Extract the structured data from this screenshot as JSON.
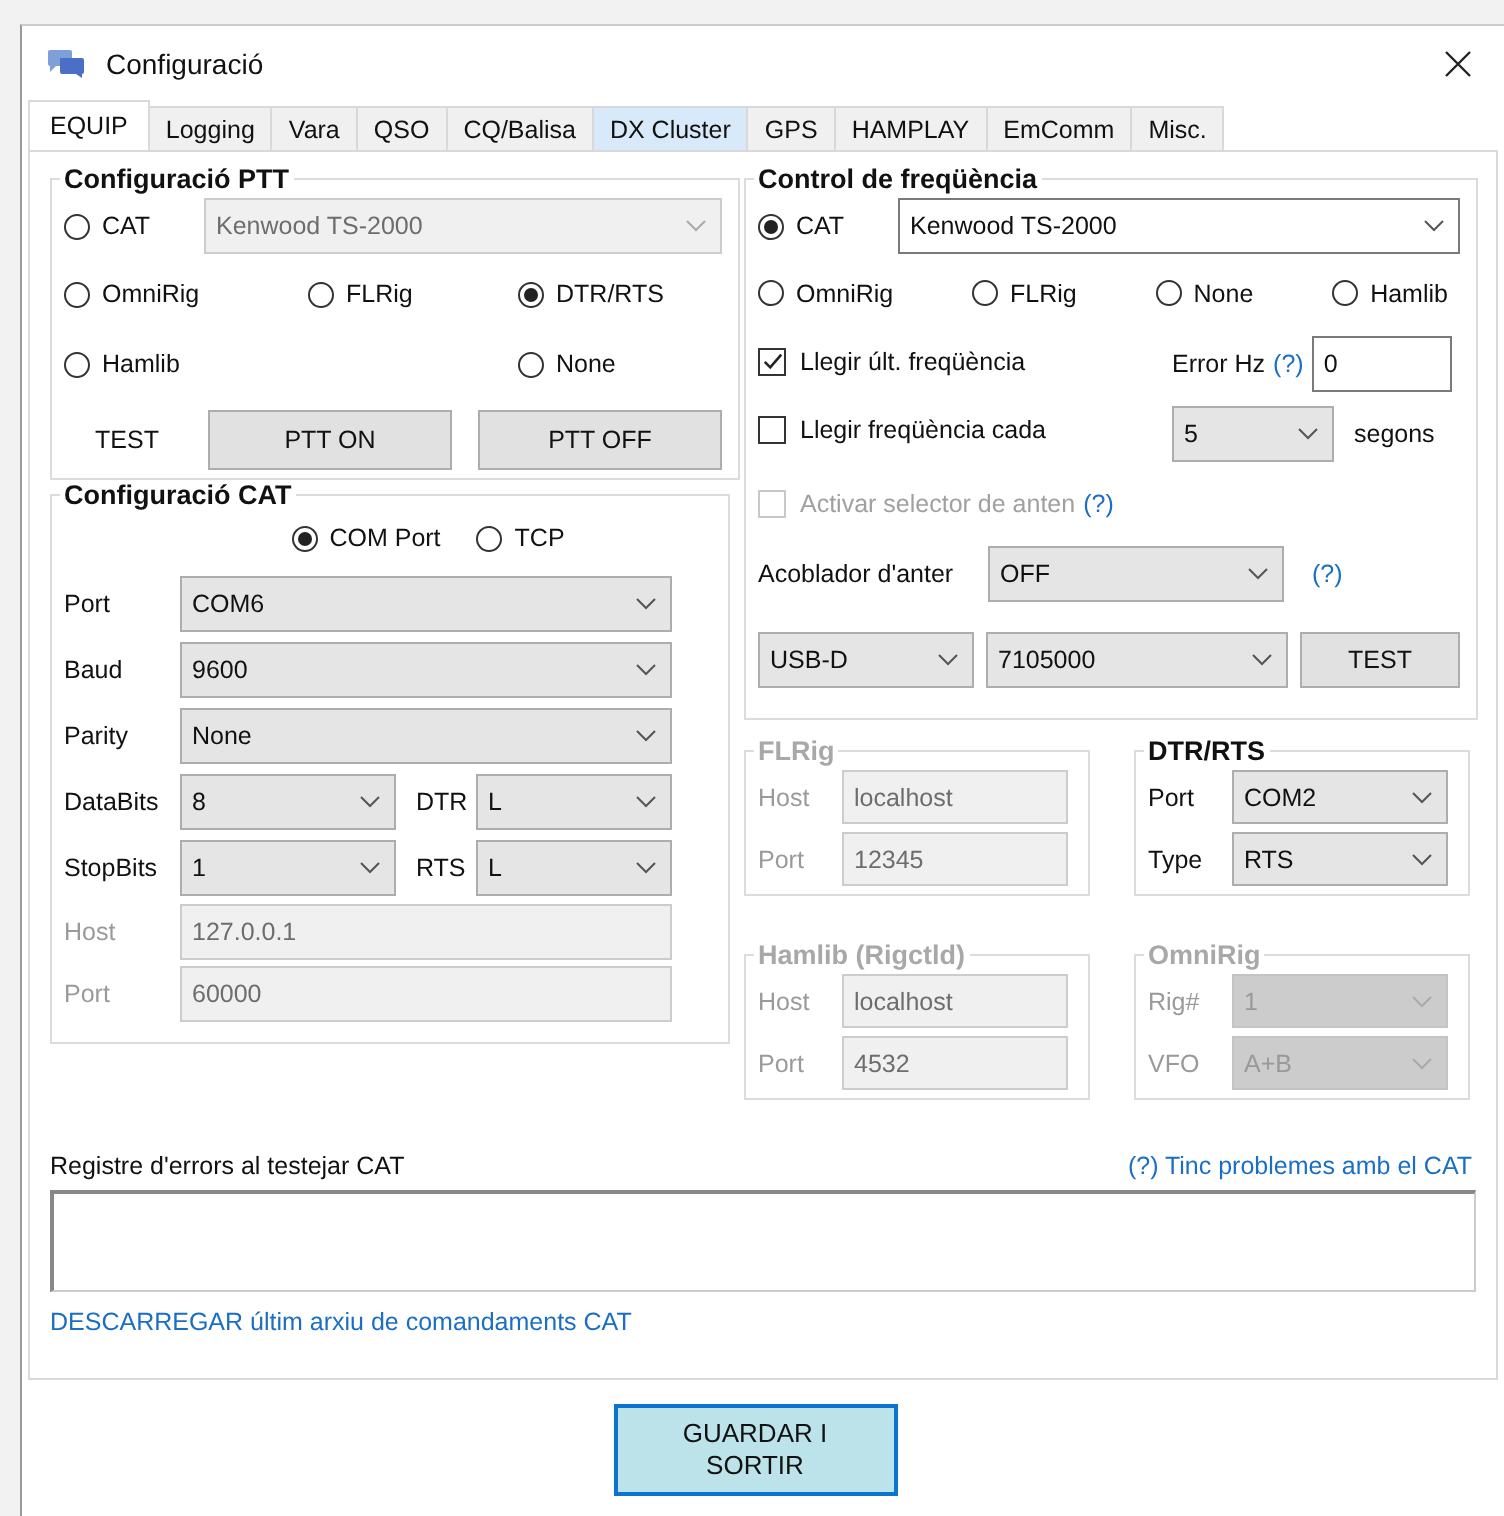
{
  "window": {
    "title": "Configuració"
  },
  "tabs": [
    {
      "label": "EQUIP",
      "selected": true,
      "highlighted": false
    },
    {
      "label": "Logging",
      "selected": false,
      "highlighted": false
    },
    {
      "label": "Vara",
      "selected": false,
      "highlighted": false
    },
    {
      "label": "QSO",
      "selected": false,
      "highlighted": false
    },
    {
      "label": "CQ/Balisa",
      "selected": false,
      "highlighted": false
    },
    {
      "label": "DX Cluster",
      "selected": false,
      "highlighted": true
    },
    {
      "label": "GPS",
      "selected": false,
      "highlighted": false
    },
    {
      "label": "HAMPLAY",
      "selected": false,
      "highlighted": false
    },
    {
      "label": "EmComm",
      "selected": false,
      "highlighted": false
    },
    {
      "label": "Misc.",
      "selected": false,
      "highlighted": false
    }
  ],
  "ptt": {
    "title": "Configuració PTT",
    "radios": [
      {
        "label": "CAT",
        "selected": false
      },
      {
        "label": "OmniRig",
        "selected": false
      },
      {
        "label": "FLRig",
        "selected": false
      },
      {
        "label": "DTR/RTS",
        "selected": true
      },
      {
        "label": "Hamlib",
        "selected": false
      },
      {
        "label": "None",
        "selected": false
      }
    ],
    "rig": {
      "value": "Kenwood TS-2000",
      "disabled": true,
      "editable": true
    },
    "test_label": "TEST",
    "buttons": [
      "PTT ON",
      "PTT OFF"
    ]
  },
  "cat": {
    "title": "Configuració CAT",
    "radios": [
      {
        "label": "COM Port",
        "selected": true
      },
      {
        "label": "TCP",
        "selected": false
      }
    ],
    "rows": [
      {
        "cells": [
          {
            "label": "Port",
            "value": "COM6",
            "kind": "dropdown",
            "disabled": false
          }
        ]
      },
      {
        "cells": [
          {
            "label": "Baud",
            "value": "9600",
            "kind": "dropdown",
            "disabled": false
          }
        ]
      },
      {
        "cells": [
          {
            "label": "Parity",
            "value": "None",
            "kind": "dropdown",
            "disabled": false
          }
        ]
      },
      {
        "cells": [
          {
            "label": "DataBits",
            "value": "8",
            "kind": "dropdown",
            "disabled": false
          },
          {
            "label": "DTR",
            "value": "L",
            "kind": "dropdown",
            "disabled": false
          }
        ]
      },
      {
        "cells": [
          {
            "label": "StopBits",
            "value": "1",
            "kind": "dropdown",
            "disabled": false
          },
          {
            "label": "RTS",
            "value": "L",
            "kind": "dropdown",
            "disabled": false
          }
        ]
      },
      {
        "cells": [
          {
            "label": "Host",
            "value": "127.0.0.1",
            "kind": "text",
            "disabled": true
          }
        ]
      },
      {
        "cells": [
          {
            "label": "Port",
            "value": "60000",
            "kind": "text",
            "disabled": true
          }
        ]
      }
    ]
  },
  "freq": {
    "title": "Control de freqüència",
    "radios": [
      {
        "label": "CAT",
        "selected": true
      },
      {
        "label": "OmniRig",
        "selected": false
      },
      {
        "label": "FLRig",
        "selected": false
      },
      {
        "label": "None",
        "selected": false
      },
      {
        "label": "Hamlib",
        "selected": false
      }
    ],
    "rig": {
      "value": "Kenwood TS-2000",
      "disabled": false,
      "editable": true
    },
    "read_last": {
      "label": "Llegir últ. freqüència",
      "checked": true,
      "disabled": false
    },
    "error_label": "Error Hz",
    "error_help": "(?)",
    "error_value": "0",
    "read_every": {
      "label": "Llegir freqüència cada",
      "checked": false,
      "disabled": false
    },
    "interval": {
      "value": "5",
      "disabled": false
    },
    "interval_unit": "segons",
    "antenna": {
      "label": "Activar selector de anten",
      "checked": false,
      "disabled": true
    },
    "antenna_help": "(?)",
    "tuner_label": "Acoblador d'anter",
    "tuner": {
      "value": "OFF",
      "disabled": false
    },
    "tuner_help": "(?)",
    "mode": {
      "value": "USB-D",
      "disabled": false
    },
    "frequency": {
      "value": "7105000",
      "disabled": false
    },
    "test_button": "TEST"
  },
  "subgroups": [
    {
      "title": "FLRig",
      "disabled": true,
      "fields": [
        {
          "label": "Host",
          "value": "localhost",
          "kind": "text",
          "disabled": true
        },
        {
          "label": "Port",
          "value": "12345",
          "kind": "text",
          "disabled": true
        }
      ]
    },
    {
      "title": "DTR/RTS",
      "disabled": false,
      "fields": [
        {
          "label": "Port",
          "value": "COM2",
          "kind": "dropdown",
          "disabled": false
        },
        {
          "label": "Type",
          "value": "RTS",
          "kind": "dropdown",
          "disabled": false
        }
      ]
    },
    {
      "title": "Hamlib (Rigctld)",
      "disabled": true,
      "fields": [
        {
          "label": "Host",
          "value": "localhost",
          "kind": "text",
          "disabled": true
        },
        {
          "label": "Port",
          "value": "4532",
          "kind": "text",
          "disabled": true
        }
      ]
    },
    {
      "title": "OmniRig",
      "disabled": true,
      "fields": [
        {
          "label": "Rig#",
          "value": "1",
          "kind": "dropdown",
          "disabled": true
        },
        {
          "label": "VFO",
          "value": "A+B",
          "kind": "dropdown",
          "disabled": true
        }
      ]
    }
  ],
  "log": {
    "label": "Registre d'errors al testejar CAT",
    "help_link": "(?) Tinc problemes amb el CAT",
    "download_link": "DESCARREGAR últim arxiu de comandaments CAT"
  },
  "save_button": "GUARDAR I SORTIR"
}
